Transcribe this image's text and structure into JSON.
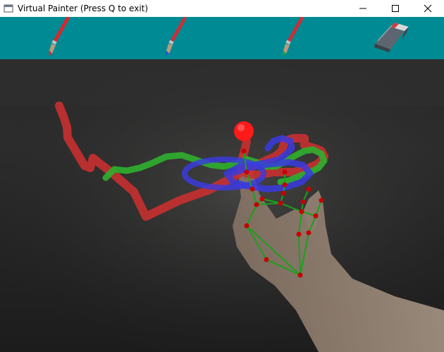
{
  "window": {
    "title": "Virtual Painter (Press Q to exit)"
  },
  "toolbar": {
    "tools": [
      {
        "name": "red-brush",
        "color": "#d9262a"
      },
      {
        "name": "blue-brush",
        "color": "#2b4fd6"
      },
      {
        "name": "green-brush",
        "color": "#2aa52a"
      },
      {
        "name": "eraser",
        "color": "#8a8f99"
      }
    ],
    "background": "#008a93"
  },
  "canvas": {
    "stroke_colors": {
      "red": "#c83030",
      "green": "#2fae2f",
      "blue": "#3a3ae0"
    },
    "cursor_color": "#ff1a1a",
    "hand_skeleton": {
      "joint_color": "#c40000",
      "bone_color": "#1aa11a"
    }
  }
}
